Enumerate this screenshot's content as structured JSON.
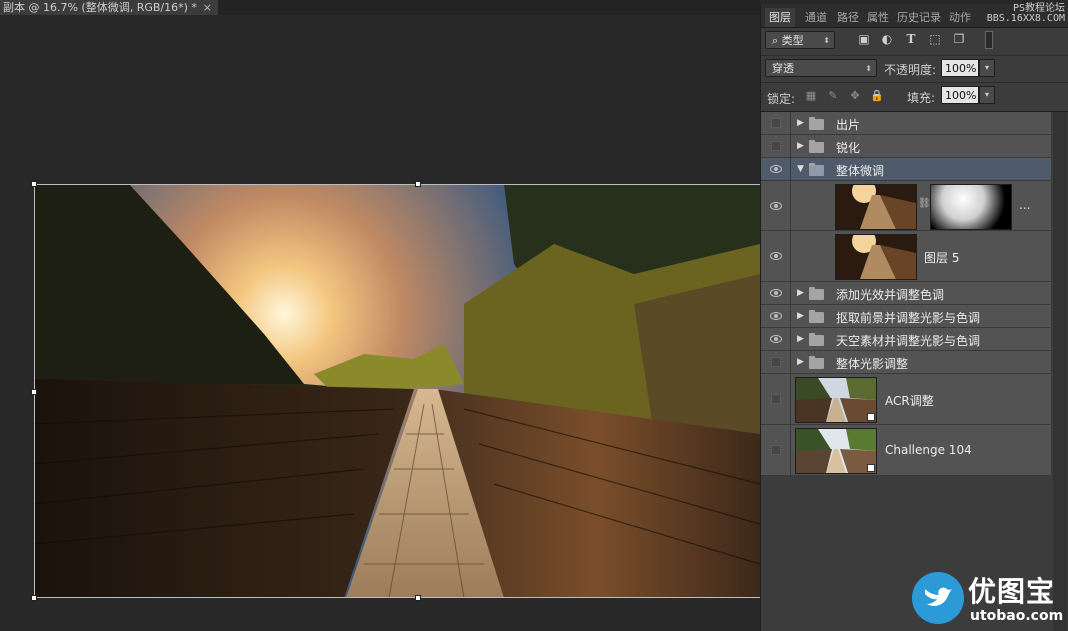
{
  "document": {
    "tab_title": "副本 @ 16.7% (整体微调, RGB/16*) *",
    "close_glyph": "×"
  },
  "panel": {
    "tabs": [
      "图层",
      "通道",
      "路径",
      "属性",
      "历史记录",
      "动作"
    ],
    "active_tab": "图层",
    "watermark_line1": "PS教程论坛",
    "watermark_line2": "BBS.16XX8.COM",
    "filter_kind": "类型",
    "blend_mode": "穿透",
    "opacity_label": "不透明度:",
    "opacity_value": "100%",
    "lock_label": "锁定:",
    "fill_label": "填充:",
    "fill_value": "100%"
  },
  "layers": [
    {
      "name": "出片",
      "type": "group",
      "visible": false,
      "expanded": false
    },
    {
      "name": "锐化",
      "type": "group",
      "visible": false,
      "expanded": false
    },
    {
      "name": "整体微调",
      "type": "group",
      "visible": true,
      "expanded": true,
      "selected": true
    },
    {
      "name": "",
      "type": "layer-with-mask",
      "visible": true,
      "more": "..."
    },
    {
      "name": "图层 5",
      "type": "layer",
      "visible": true
    },
    {
      "name": "添加光效并调整色调",
      "type": "group",
      "visible": true,
      "expanded": false
    },
    {
      "name": "抠取前景并调整光影与色调",
      "type": "group",
      "visible": true,
      "expanded": false
    },
    {
      "name": "天空素材并调整光影与色调",
      "type": "group",
      "visible": true,
      "expanded": false
    },
    {
      "name": "整体光影调整",
      "type": "group",
      "visible": false,
      "expanded": false
    },
    {
      "name": "ACR调整",
      "type": "smart-object",
      "visible": false
    },
    {
      "name": "Challenge 104",
      "type": "smart-object",
      "visible": false
    }
  ],
  "logo": {
    "text": "优图宝",
    "url": "utobao.com"
  },
  "colors": {
    "background": "#282828",
    "panel": "#3c3c3c",
    "layer_row": "#535353",
    "selected_row": "#4f5a6a",
    "logo_blue": "#2b9ad6"
  }
}
